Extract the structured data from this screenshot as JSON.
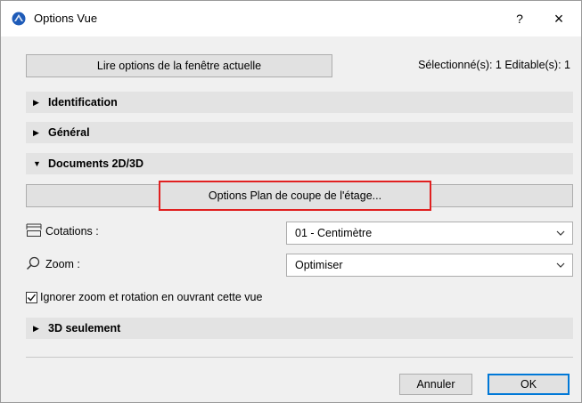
{
  "window": {
    "title": "Options Vue",
    "help_glyph": "?",
    "close_glyph": "×"
  },
  "top": {
    "read_button_label": "Lire options de la fenêtre actuelle",
    "selection_info": "Sélectionné(s): 1 Editable(s): 1"
  },
  "sections": {
    "identification": "Identification",
    "general": "Général",
    "documents": "Documents 2D/3D",
    "only3d": "3D seulement"
  },
  "documents": {
    "plan_button_label": "Options Plan de coupe de l'étage...",
    "cotations_label": "Cotations :",
    "cotations_value": "01 - Centimètre",
    "zoom_label": "Zoom :",
    "zoom_value": "Optimiser",
    "ignore_label": "Ignorer zoom et rotation en ouvrant cette vue",
    "ignore_checked": true
  },
  "footer": {
    "cancel_label": "Annuler",
    "ok_label": "OK"
  },
  "colors": {
    "highlight": "#e02020",
    "default_button_border": "#0078d7",
    "app_icon": "#1e5bb8"
  },
  "icons": {
    "app": "archicad-app-icon",
    "collapsed": "triangle-right-icon",
    "expanded": "triangle-down-icon",
    "cotations": "dimension-icon",
    "zoom": "magnifier-icon",
    "dropdown": "chevron-down-icon",
    "check": "checkmark-icon"
  }
}
